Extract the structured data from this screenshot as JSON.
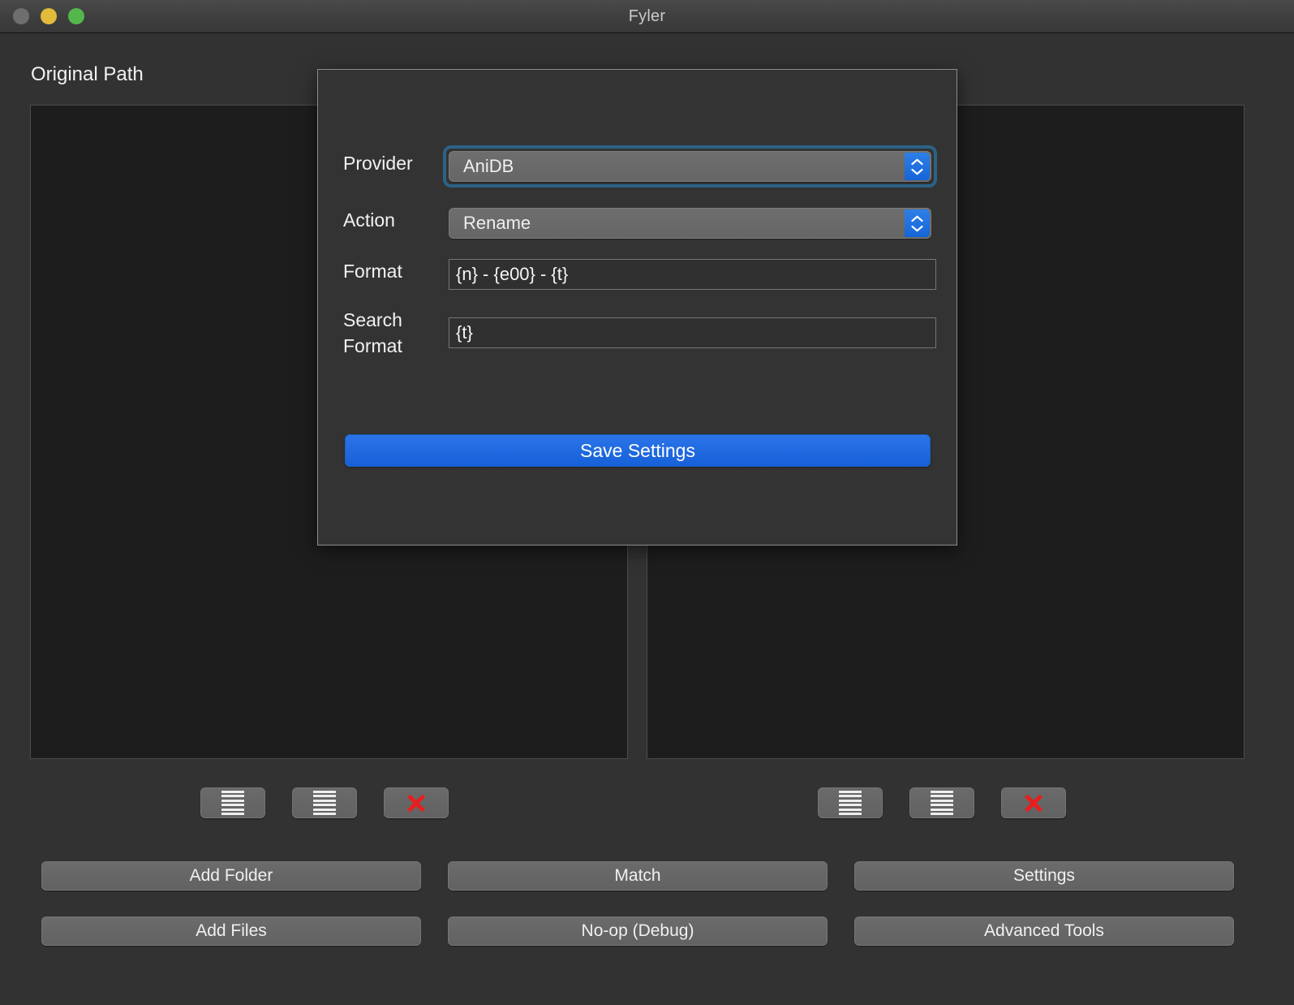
{
  "window": {
    "title": "Fyler",
    "traffic_lights": [
      "close-button",
      "minimize-button",
      "zoom-button"
    ]
  },
  "main": {
    "left_pane_header": "Original Path",
    "left_pane_items": [],
    "right_pane_items": [],
    "icon_buttons_left": [
      {
        "name": "select-all-left-button",
        "icon": "list-lines-icon"
      },
      {
        "name": "deselect-all-left-button",
        "icon": "list-lines-icon"
      },
      {
        "name": "remove-left-button",
        "icon": "red-x-icon"
      }
    ],
    "icon_buttons_right": [
      {
        "name": "select-all-right-button",
        "icon": "list-lines-icon"
      },
      {
        "name": "deselect-all-right-button",
        "icon": "list-lines-icon"
      },
      {
        "name": "remove-right-button",
        "icon": "red-x-icon"
      }
    ],
    "actions": [
      {
        "name": "add-folder-button",
        "label": "Add Folder"
      },
      {
        "name": "match-button",
        "label": "Match"
      },
      {
        "name": "settings-button",
        "label": "Settings"
      },
      {
        "name": "add-files-button",
        "label": "Add Files"
      },
      {
        "name": "no-op-debug-button",
        "label": "No-op (Debug)"
      },
      {
        "name": "advanced-tools-button",
        "label": "Advanced Tools"
      }
    ]
  },
  "dialog": {
    "provider": {
      "label": "Provider",
      "value": "AniDB",
      "focused": true
    },
    "action": {
      "label": "Action",
      "value": "Rename",
      "focused": false
    },
    "format": {
      "label": "Format",
      "value": "{n} - {e00} - {t}",
      "placeholder": ""
    },
    "search_format": {
      "label_line1": "Search",
      "label_line2": "Format",
      "value": "{t}",
      "placeholder": ""
    },
    "save_label": "Save Settings"
  },
  "colors": {
    "accent_blue": "#1660d9",
    "focus_ring": "#2b6286",
    "danger_red": "#e81e1e",
    "window_bg": "#323232",
    "dialog_bg": "#333333",
    "pane_bg": "#1d1d1d"
  }
}
